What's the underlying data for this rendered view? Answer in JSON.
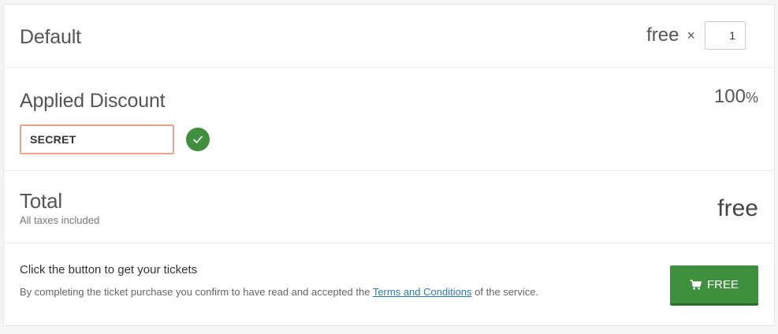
{
  "ticket": {
    "name": "Default",
    "price": "free",
    "times": "×",
    "quantity": "1"
  },
  "discount": {
    "title": "Applied Discount",
    "code": "SECRET",
    "value": "100",
    "percent_sign": "%",
    "status_icon": "check-icon"
  },
  "total": {
    "title": "Total",
    "taxes_note": "All taxes included",
    "value": "free"
  },
  "checkout": {
    "title": "Click the button to get your tickets",
    "note_before": "By completing the ticket purchase you confirm to have read and accepted the ",
    "terms_link": "Terms and Conditions",
    "note_after": " of the service.",
    "button_label": "FREE",
    "button_icon": "cart-icon"
  },
  "colors": {
    "accent_green": "#3f8f3f",
    "input_highlight": "#e8a58a",
    "link_blue": "#2a7ab0"
  }
}
